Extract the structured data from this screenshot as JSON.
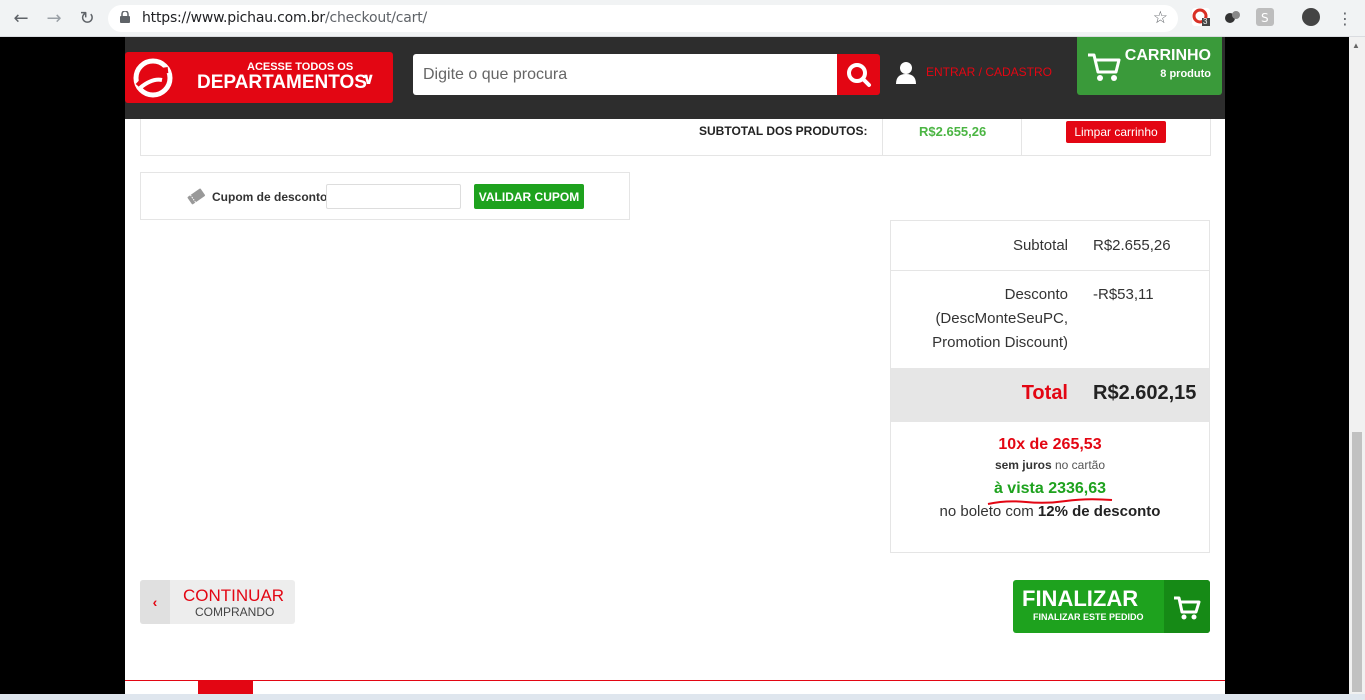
{
  "browser": {
    "url_host": "https://www.pichau.com.br",
    "url_path": "/checkout/cart/",
    "ext_badge": "3"
  },
  "header": {
    "dept_small": "ACESSE TODOS OS",
    "dept_big": "DEPARTAMENTOS",
    "search_placeholder": "Digite o que procura",
    "login_label": "ENTRAR / CADASTRO",
    "cart_title": "CARRINHO",
    "cart_count": "8 produto"
  },
  "cart": {
    "subtotal_label": "SUBTOTAL DOS PRODUTOS:",
    "subtotal_value": "R$2.655,26",
    "clear_label": "Limpar carrinho"
  },
  "coupon": {
    "label": "Cupom de desconto:",
    "button": "VALIDAR CUPOM"
  },
  "totals": {
    "subtotal_label": "Subtotal",
    "subtotal_value": "R$2.655,26",
    "discount_line1": "Desconto",
    "discount_line2": "(DescMonteSeuPC,",
    "discount_line3": "Promotion Discount)",
    "discount_value": "-R$53,11",
    "total_label": "Total",
    "total_value": "R$2.602,15",
    "installments": "10x de 265,53",
    "interest_bold": "sem juros",
    "interest_rest": "no cartão",
    "cash": "à vista 2336,63",
    "boleto_text": "no boleto com",
    "boleto_bold": "12% de desconto"
  },
  "actions": {
    "continue_big": "CONTINUAR",
    "continue_small": "COMPRANDO",
    "finalize_big": "FINALIZAR",
    "finalize_small": "FINALIZAR ESTE PEDIDO"
  },
  "colors": {
    "brand_red": "#e30613",
    "brand_green": "#1ea21e",
    "header_dark": "#2d2d2d"
  }
}
